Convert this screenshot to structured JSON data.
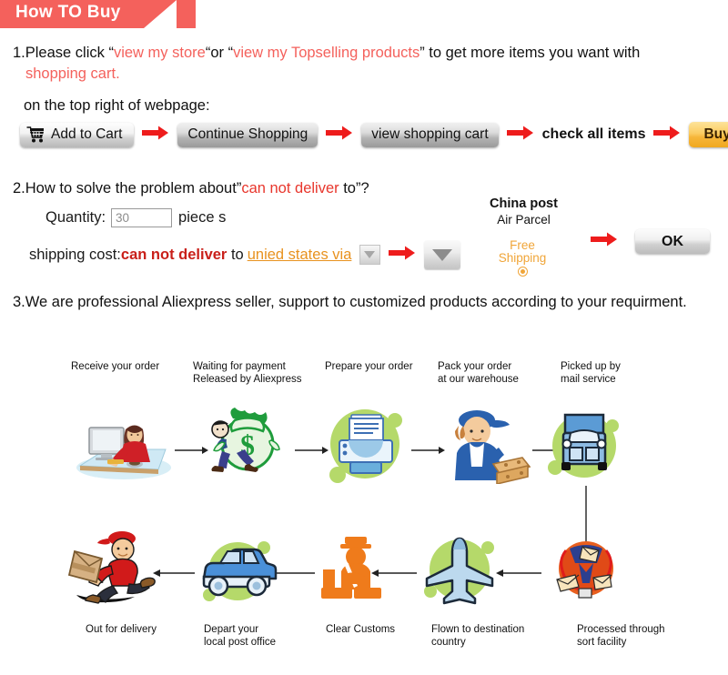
{
  "banner": {
    "title": "How TO Buy"
  },
  "section1": {
    "number": "1.",
    "text_a": "Please click “",
    "link_store": "view my store",
    "text_b": "“or “",
    "link_topselling": "view my Topselling products",
    "text_c": "” to get more items you want with",
    "line2": "shopping cart.",
    "line3": "on the top right of webpage:",
    "buttons": [
      {
        "label": "Add to Cart",
        "icon": "shopping-cart-icon",
        "style": "light"
      },
      {
        "label": "Continue Shopping",
        "style": "dark"
      },
      {
        "label": "view shopping cart",
        "style": "dark"
      },
      {
        "label": "check all items",
        "style": "plain"
      },
      {
        "label": "Buy now",
        "style": "orange"
      }
    ]
  },
  "section2": {
    "number": "2.",
    "question_a": "How to solve the problem about”",
    "question_red": "can not deliver",
    "question_b": " to”?",
    "quantity_label": "Quantity:",
    "quantity_value": "30",
    "quantity_unit": "piece s",
    "shipping_label": "shipping cost:",
    "shipping_status": "can not deliver",
    "shipping_to": "to",
    "shipping_destination": "unied states via",
    "carrier_name": "China post",
    "carrier_service": "Air Parcel",
    "free_shipping_line1": "Free",
    "free_shipping_line2": "Shipping",
    "ok_label": "OK"
  },
  "section3": {
    "number": "3.",
    "text": "We are professional Aliexpress seller, support to customized products according to your requirment."
  },
  "flow": {
    "top_steps": [
      {
        "label_lines": [
          "Receive your order"
        ],
        "icon": "person-at-computer-icon"
      },
      {
        "label_lines": [
          "Waiting for payment",
          "Released by Aliexpress"
        ],
        "icon": "money-bag-icon"
      },
      {
        "label_lines": [
          "Prepare your order"
        ],
        "icon": "printer-icon"
      },
      {
        "label_lines": [
          "Pack your order",
          "at our warehouse"
        ],
        "icon": "worker-packing-icon"
      },
      {
        "label_lines": [
          "Picked up by",
          "mail service"
        ],
        "icon": "delivery-truck-icon"
      }
    ],
    "bottom_steps": [
      {
        "label_lines": [
          "Out for delivery"
        ],
        "icon": "running-courier-icon"
      },
      {
        "label_lines": [
          "Depart your",
          "local post office"
        ],
        "icon": "delivery-van-icon"
      },
      {
        "label_lines": [
          "Clear Customs"
        ],
        "icon": "customs-officer-icon"
      },
      {
        "label_lines": [
          "Flown to destination",
          "country"
        ],
        "icon": "airplane-icon"
      },
      {
        "label_lines": [
          "Processed through",
          "sort facility"
        ],
        "icon": "mail-sorting-icon"
      }
    ]
  },
  "colors": {
    "banner_red": "#f4615c",
    "link_red": "#f4615c",
    "alert_red": "#e8362c",
    "strong_red": "#c9201a",
    "orange": "#e8921f",
    "buy_now_orange": "#f6b63a",
    "flow_green": "#b5d96a",
    "flow_blue": "#5b9bd5"
  }
}
